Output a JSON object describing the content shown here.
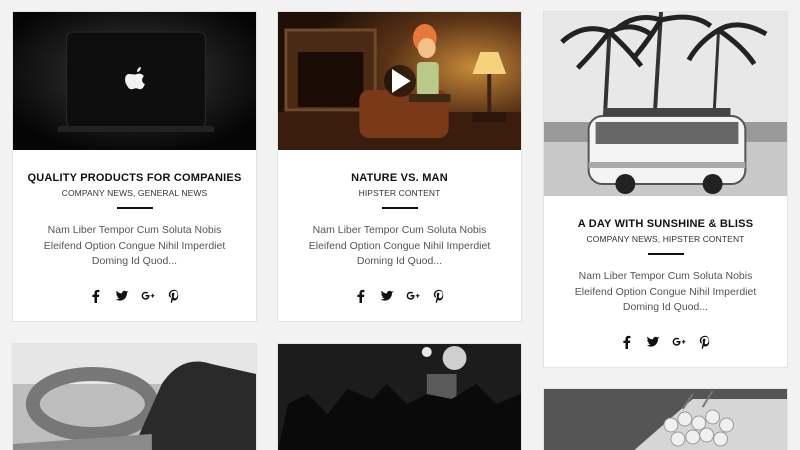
{
  "posts": [
    {
      "title": "QUALITY PRODUCTS FOR COMPANIES",
      "categories": "COMPANY NEWS, GENERAL NEWS",
      "excerpt": "Nam Liber Tempor Cum Soluta Nobis Eleifend Option Congue Nihil Imperdiet Doming Id Quod..."
    },
    {
      "title": "NATURE VS. MAN",
      "categories": "HIPSTER CONTENT",
      "excerpt": "Nam Liber Tempor Cum Soluta Nobis Eleifend Option Congue Nihil Imperdiet Doming Id Quod..."
    },
    {
      "title": "A DAY WITH SUNSHINE & BLISS",
      "categories": "COMPANY NEWS, HIPSTER CONTENT",
      "excerpt": "Nam Liber Tempor Cum Soluta Nobis Eleifend Option Congue Nihil Imperdiet Doming Id Quod..."
    }
  ],
  "share_icons": [
    "facebook-icon",
    "twitter-icon",
    "google-plus-icon",
    "pinterest-icon"
  ],
  "colors": {
    "page_bg": "#f2f2f2",
    "card_bg": "#ffffff",
    "title": "#111111",
    "excerpt": "#555555"
  }
}
